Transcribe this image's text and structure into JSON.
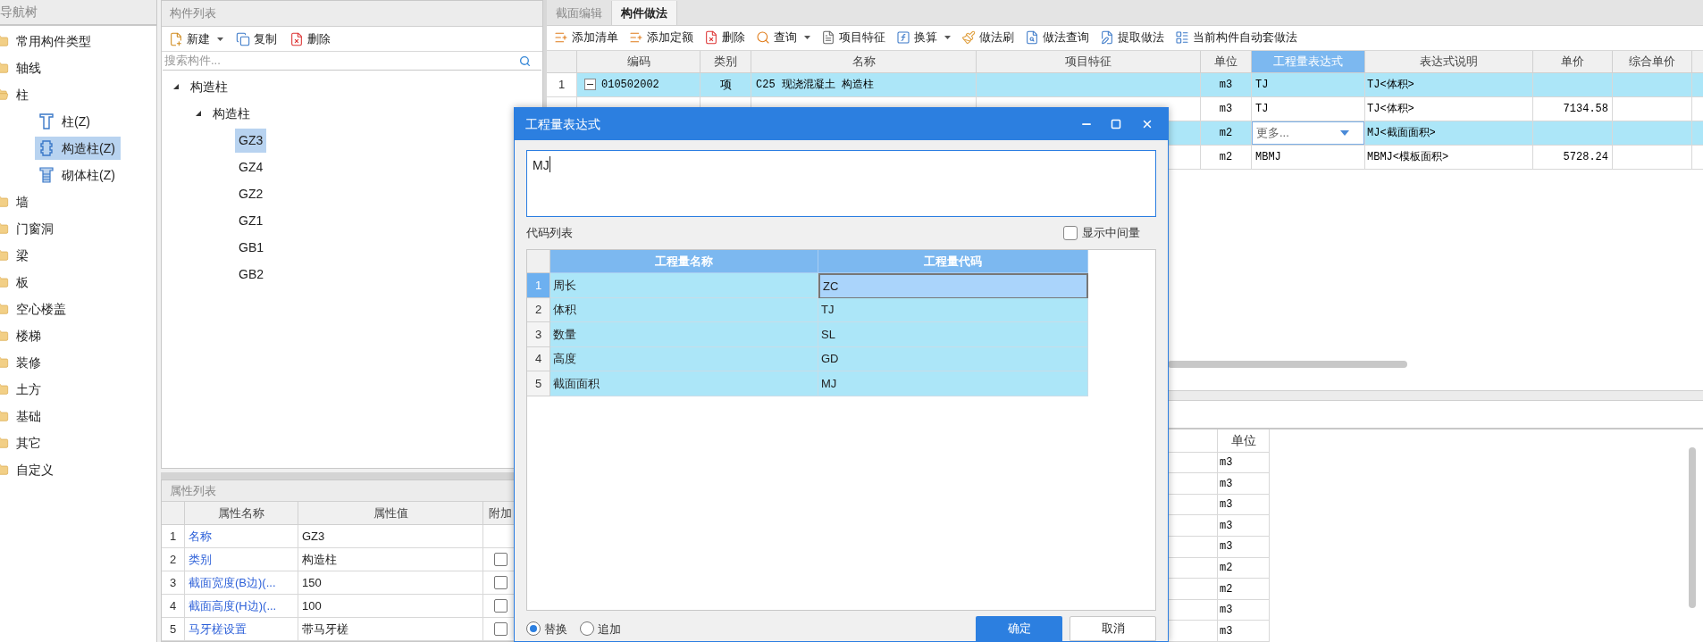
{
  "nav_tree": {
    "title": "导航树",
    "items": [
      {
        "label": "常用构件类型",
        "expanded": false
      },
      {
        "label": "轴线",
        "expanded": false
      },
      {
        "label": "柱",
        "expanded": true,
        "children": [
          {
            "label": "柱(Z)",
            "kind": "column",
            "selected": false
          },
          {
            "label": "构造柱(Z)",
            "kind": "constructional",
            "selected": true
          },
          {
            "label": "砌体柱(Z)",
            "kind": "masonry",
            "selected": false
          }
        ]
      },
      {
        "label": "墙",
        "expanded": false
      },
      {
        "label": "门窗洞",
        "expanded": false
      },
      {
        "label": "梁",
        "expanded": false
      },
      {
        "label": "板",
        "expanded": false
      },
      {
        "label": "空心楼盖",
        "expanded": false
      },
      {
        "label": "楼梯",
        "expanded": false
      },
      {
        "label": "装修",
        "expanded": false
      },
      {
        "label": "土方",
        "expanded": false
      },
      {
        "label": "基础",
        "expanded": false
      },
      {
        "label": "其它",
        "expanded": false
      },
      {
        "label": "自定义",
        "expanded": false
      }
    ]
  },
  "component_list": {
    "title": "构件列表",
    "toolbar": [
      {
        "label": "新建",
        "kind": "new",
        "dropdown": true
      },
      {
        "label": "复制",
        "kind": "copy",
        "dropdown": false
      },
      {
        "label": "删除",
        "kind": "delete",
        "dropdown": false
      }
    ],
    "search": {
      "placeholder": "搜索构件..."
    },
    "tree": [
      {
        "label": "构造柱",
        "expanded": true,
        "children": [
          {
            "label": "构造柱",
            "expanded": true,
            "children": [
              {
                "label": "GZ3",
                "selected": true
              },
              {
                "label": "GZ4",
                "selected": false
              },
              {
                "label": "GZ2",
                "selected": false
              },
              {
                "label": "GZ1",
                "selected": false
              },
              {
                "label": "GB1",
                "selected": false
              },
              {
                "label": "GB2",
                "selected": false
              }
            ]
          }
        ]
      }
    ]
  },
  "property_list": {
    "title": "属性列表",
    "columns": [
      "属性名称",
      "属性值",
      "附加"
    ],
    "rows": [
      {
        "index": "1",
        "name": "名称",
        "value": "GZ3"
      },
      {
        "index": "2",
        "name": "类别",
        "value": "构造柱",
        "checkbox": {
          "checked": false
        }
      },
      {
        "index": "3",
        "name": "截面宽度(B边)(...",
        "value": "150",
        "checkbox": {
          "checked": false
        }
      },
      {
        "index": "4",
        "name": "截面高度(H边)(...",
        "value": "100",
        "checkbox": {
          "checked": false
        }
      },
      {
        "index": "5",
        "name": "马牙槎设置",
        "value": "带马牙槎",
        "checkbox": {
          "checked": false
        }
      }
    ]
  },
  "method_panel": {
    "tabs": [
      {
        "label": "截面编辑",
        "selected": false
      },
      {
        "label": "构件做法",
        "selected": true
      }
    ],
    "toolbar": [
      {
        "label": "添加清单",
        "kind": "add-list",
        "dropdown": false
      },
      {
        "label": "添加定额",
        "kind": "add-quota",
        "dropdown": false
      },
      {
        "label": "删除",
        "kind": "delete",
        "dropdown": false
      },
      {
        "label": "查询",
        "kind": "search",
        "dropdown": true
      },
      {
        "label": "项目特征",
        "kind": "feature",
        "dropdown": false
      },
      {
        "label": "换算",
        "kind": "function",
        "dropdown": true
      },
      {
        "label": "做法刷",
        "kind": "brush",
        "dropdown": false
      },
      {
        "label": "做法查询",
        "kind": "file-search",
        "dropdown": false
      },
      {
        "label": "提取做法",
        "kind": "extract",
        "dropdown": false
      },
      {
        "label": "当前构件自动套做法",
        "kind": "auto",
        "dropdown": false
      }
    ],
    "columns": [
      {
        "label": "编码",
        "selected": false
      },
      {
        "label": "类别",
        "selected": false
      },
      {
        "label": "名称",
        "selected": false
      },
      {
        "label": "项目特征",
        "selected": false
      },
      {
        "label": "单位",
        "selected": false
      },
      {
        "label": "工程量表达式",
        "selected": true
      },
      {
        "label": "表达式说明",
        "selected": false
      },
      {
        "label": "单价",
        "selected": false
      },
      {
        "label": "综合单价",
        "selected": false
      }
    ],
    "rows": [
      {
        "index": "1",
        "expanded": true,
        "code": "010502002",
        "category": "项",
        "name": "C25 现浇混凝土 构造柱",
        "unit": "m3",
        "expression": {
          "text": "TJ",
          "kind": "text"
        },
        "description": "TJ<体积>",
        "highlighted": true
      },
      {
        "unit": "m3",
        "expression": {
          "text": "TJ",
          "kind": "text"
        },
        "description": "TJ<体积>",
        "price": "7134.58",
        "highlighted": false
      },
      {
        "unit": "m2",
        "expression": {
          "text": "更多...",
          "kind": "dropdown"
        },
        "description": "MJ<截面面积>",
        "highlighted": true
      },
      {
        "unit": "m2",
        "expression": {
          "text": "MBMJ",
          "kind": "text"
        },
        "description": "MBMJ<模板面积>",
        "price": "5728.24",
        "highlighted": false
      }
    ],
    "lower_table": {
      "columns": [
        "单位"
      ],
      "rows": [
        "m3",
        "m3",
        "m3",
        "m3",
        "m3",
        "m2",
        "m2",
        "m3",
        "m3"
      ]
    }
  },
  "dialog": {
    "title": "工程量表达式",
    "expression": "MJ",
    "code_list_label": "代码列表",
    "show_intermediate": {
      "label": "显示中间量",
      "checked": false
    },
    "columns": [
      "工程量名称",
      "工程量代码"
    ],
    "rows": [
      {
        "index": "1",
        "name": "周长",
        "code": "ZC",
        "selected": true
      },
      {
        "index": "2",
        "name": "体积",
        "code": "TJ",
        "selected": false
      },
      {
        "index": "3",
        "name": "数量",
        "code": "SL",
        "selected": false
      },
      {
        "index": "4",
        "name": "高度",
        "code": "GD",
        "selected": false
      },
      {
        "index": "5",
        "name": "截面面积",
        "code": "MJ",
        "selected": false
      }
    ],
    "modes": [
      {
        "label": "替换",
        "selected": true
      },
      {
        "label": "追加",
        "selected": false
      }
    ],
    "buttons": [
      {
        "label": "确定",
        "kind": "primary"
      },
      {
        "label": "取消",
        "kind": "secondary"
      }
    ]
  }
}
